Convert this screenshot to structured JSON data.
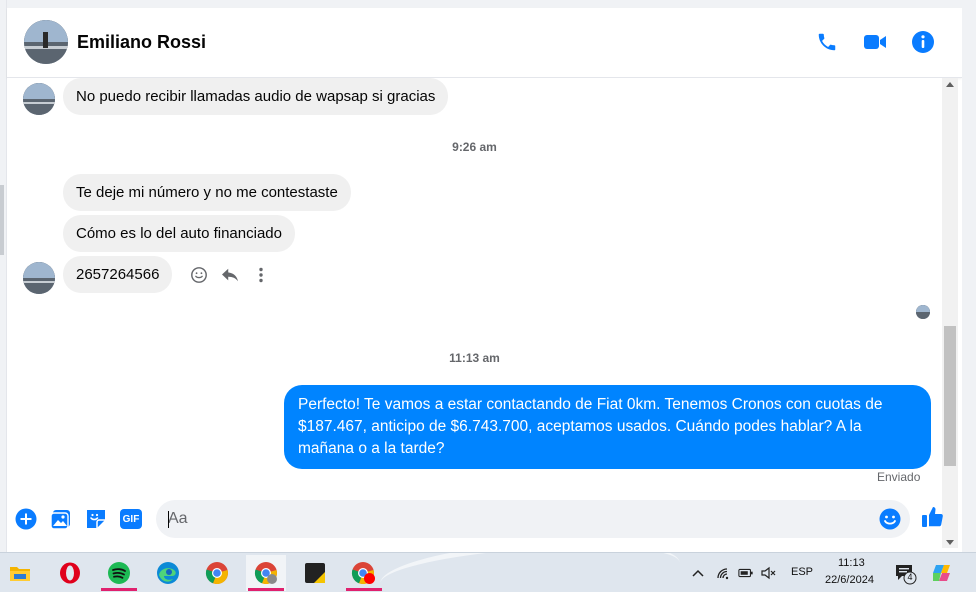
{
  "header": {
    "contact_name": "Emiliano Rossi",
    "actions": [
      {
        "name": "phone-icon",
        "label": "Llamada de voz"
      },
      {
        "name": "video-icon",
        "label": "Videollamada"
      },
      {
        "name": "info-icon",
        "label": "Información"
      }
    ],
    "accent_color": "#0084ff"
  },
  "chat": {
    "messages_before": [
      {
        "from": "contact",
        "text": "No puedo recibir llamadas audio de wapsap si gracias"
      }
    ],
    "timestamp_1": "9:26 am",
    "messages_group": [
      {
        "from": "contact",
        "text": "Te deje mi número y no me contestaste"
      },
      {
        "from": "contact",
        "text": "Cómo es lo del auto financiado"
      },
      {
        "from": "contact",
        "text": "2657264566"
      }
    ],
    "timestamp_2": "11:13 am",
    "outgoing": {
      "text": "Perfecto! Te vamos a estar contactando de Fiat 0km. Tenemos Cronos con cuotas de $187.467, anticipo de $6.743.700, aceptamos usados. Cuándo podes hablar? A la mañana o a la tarde?",
      "status": "Enviado"
    }
  },
  "composer": {
    "placeholder": "Aa",
    "gif_label": "GIF"
  },
  "taskbar": {
    "apps": [
      {
        "name": "file-explorer",
        "active": false
      },
      {
        "name": "opera",
        "active": false
      },
      {
        "name": "spotify",
        "active": false,
        "underline": true
      },
      {
        "name": "edge",
        "active": false
      },
      {
        "name": "chrome",
        "active": false
      },
      {
        "name": "chrome-profile",
        "active": true,
        "underline": true
      },
      {
        "name": "sticky-app",
        "active": false
      },
      {
        "name": "chrome-notify",
        "active": false,
        "underline": true
      }
    ],
    "language": "ESP",
    "time": "11:13",
    "date": "22/6/2024",
    "notification_count": "4"
  }
}
